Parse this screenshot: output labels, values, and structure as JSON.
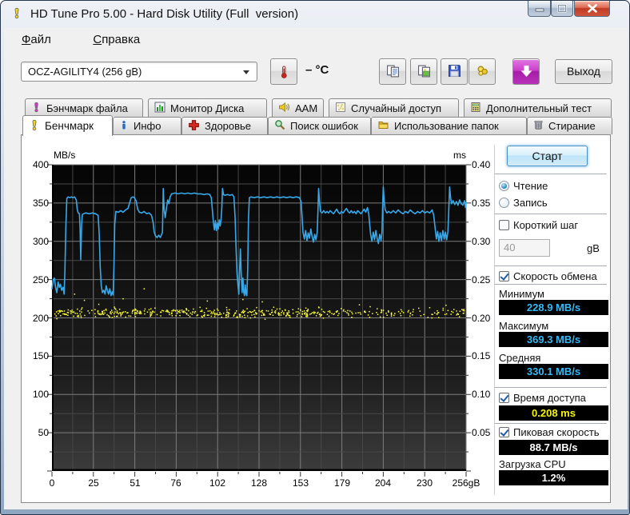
{
  "window": {
    "title": "HD Tune Pro 5.00 - Hard Disk Utility (Full  version)",
    "app_icon": "gauge-yellow-icon",
    "buttons": {
      "minimize": "minimize",
      "maximize": "maximize",
      "close": "close"
    }
  },
  "menu": {
    "items": [
      {
        "label": "Файл"
      },
      {
        "label": "Справка"
      }
    ]
  },
  "toolbar": {
    "drive_select": "OCZ-AGILITY4 (256 gB)",
    "temperature": "– °C",
    "buttons": [
      {
        "name": "copy",
        "icon": "copy-icon"
      },
      {
        "name": "copy-image",
        "icon": "copy-image-icon"
      },
      {
        "name": "save",
        "icon": "save-icon"
      },
      {
        "name": "options",
        "icon": "options-icon"
      },
      {
        "name": "screenshot",
        "icon": "screenshot-icon"
      }
    ],
    "exit_label": "Выход"
  },
  "tabs": {
    "row1": [
      {
        "label": "Бэнчмарк файла",
        "icon": "gauge-magenta-icon"
      },
      {
        "label": "Монитор Диска",
        "icon": "bar-chart-icon"
      },
      {
        "label": "AAM",
        "icon": "speaker-icon"
      },
      {
        "label": "Случайный доступ",
        "icon": "random-access-icon"
      },
      {
        "label": "Дополнительный тест",
        "icon": "calculator-icon"
      }
    ],
    "row2": [
      {
        "label": "Бенчмарк",
        "icon": "gauge-yellow-icon",
        "active": true
      },
      {
        "label": "Инфо",
        "icon": "info-icon"
      },
      {
        "label": "Здоровье",
        "icon": "health-cross-icon"
      },
      {
        "label": "Поиск ошибок",
        "icon": "magnifier-icon"
      },
      {
        "label": "Использование папок",
        "icon": "folder-icon"
      },
      {
        "label": "Стирание",
        "icon": "trash-icon"
      }
    ]
  },
  "benchmark_panel": {
    "start_button": "Старт",
    "read_radio": "Чтение",
    "write_radio": "Запись",
    "short_stride_checkbox": "Короткий шаг",
    "stride_value": "40",
    "stride_unit": "gB",
    "transfer_checkbox": "Скорость обмена",
    "min_label": "Минимум",
    "min_value": "228.9 MB/s",
    "max_label": "Максимум",
    "max_value": "369.3 MB/s",
    "avg_label": "Средняя",
    "avg_value": "330.1 MB/s",
    "access_checkbox": "Время доступа",
    "access_value": "0.208 ms",
    "burst_checkbox": "Пиковая скорость",
    "burst_value": "88.7 MB/s",
    "cpu_label": "Загрузка CPU",
    "cpu_value": "1.2%"
  },
  "chart_data": {
    "type": "line",
    "title": "",
    "x_axis": {
      "range": [
        0,
        256
      ],
      "ticks": [
        "0",
        "25",
        "51",
        "76",
        "102",
        "128",
        "153",
        "179",
        "204",
        "230",
        "256gB"
      ]
    },
    "y_left": {
      "label": "MB/s",
      "range": [
        0,
        400
      ],
      "ticks": [
        400,
        350,
        300,
        250,
        200,
        150,
        100,
        50
      ]
    },
    "y_right": {
      "label": "ms",
      "range": [
        0,
        0.4
      ],
      "ticks": [
        "0.40",
        "0.35",
        "0.30",
        "0.25",
        "0.20",
        "0.15",
        "0.10",
        "0.05"
      ]
    },
    "grid": {
      "major_color": "#7d7d7d",
      "minor_color": "#484848"
    },
    "series": [
      {
        "name": "transfer-rate",
        "type": "line",
        "color": "#37a8ea",
        "points": [
          [
            0,
            238
          ],
          [
            0.8,
            250
          ],
          [
            1.5,
            252
          ],
          [
            2.2,
            240
          ],
          [
            3,
            233
          ],
          [
            3.8,
            247
          ],
          [
            4.5,
            240
          ],
          [
            5.2,
            244
          ],
          [
            6,
            236
          ],
          [
            6.8,
            240
          ],
          [
            7.5,
            231
          ],
          [
            8,
            262
          ],
          [
            8.6,
            320
          ],
          [
            9.2,
            356
          ],
          [
            10,
            358
          ],
          [
            11,
            357
          ],
          [
            12,
            358
          ],
          [
            13,
            357
          ],
          [
            14,
            358
          ],
          [
            15,
            354
          ],
          [
            15.6,
            342
          ],
          [
            16.2,
            337
          ],
          [
            17,
            336
          ],
          [
            17.4,
            315
          ],
          [
            17.8,
            276
          ],
          [
            18.3,
            320
          ],
          [
            18.8,
            335
          ],
          [
            19.5,
            336
          ],
          [
            21,
            337
          ],
          [
            23,
            336
          ],
          [
            25,
            337
          ],
          [
            27,
            336
          ],
          [
            28.5,
            334
          ],
          [
            29.2,
            310
          ],
          [
            29.8,
            268
          ],
          [
            30.5,
            242
          ],
          [
            31.2,
            233
          ],
          [
            32,
            236
          ],
          [
            32.8,
            231
          ],
          [
            33.5,
            242
          ],
          [
            34.2,
            236
          ],
          [
            35,
            231
          ],
          [
            35.8,
            238
          ],
          [
            36.5,
            229
          ],
          [
            37.2,
            234
          ],
          [
            37.8,
            230
          ],
          [
            38.3,
            266
          ],
          [
            38.8,
            322
          ],
          [
            39.5,
            339
          ],
          [
            41,
            338
          ],
          [
            42.5,
            340
          ],
          [
            44,
            338
          ],
          [
            45.5,
            341
          ],
          [
            47,
            343
          ],
          [
            48,
            350
          ],
          [
            49,
            357
          ],
          [
            50,
            358
          ],
          [
            51,
            357
          ],
          [
            52,
            353
          ],
          [
            53,
            342
          ],
          [
            54,
            338
          ],
          [
            55.5,
            337
          ],
          [
            57,
            339
          ],
          [
            58.5,
            336
          ],
          [
            60,
            337
          ],
          [
            61.5,
            334
          ],
          [
            62.5,
            325
          ],
          [
            63.2,
            312
          ],
          [
            64,
            307
          ],
          [
            65,
            305
          ],
          [
            66,
            308
          ],
          [
            67,
            305
          ],
          [
            67.8,
            309
          ],
          [
            68.3,
            312
          ],
          [
            68.8,
            369
          ],
          [
            69.4,
            341
          ],
          [
            70,
            331
          ],
          [
            70.8,
            344
          ],
          [
            71.5,
            354
          ],
          [
            72.3,
            349
          ],
          [
            73,
            358
          ],
          [
            74,
            362
          ],
          [
            76,
            363
          ],
          [
            78,
            362
          ],
          [
            80,
            363
          ],
          [
            82,
            362
          ],
          [
            84,
            363
          ],
          [
            86,
            362
          ],
          [
            88,
            363
          ],
          [
            90,
            362
          ],
          [
            92,
            362
          ],
          [
            94,
            361
          ],
          [
            96,
            362
          ],
          [
            97.5,
            361
          ],
          [
            98.5,
            357
          ],
          [
            99.2,
            340
          ],
          [
            99.8,
            325
          ],
          [
            100.4,
            315
          ],
          [
            101,
            327
          ],
          [
            101.6,
            314
          ],
          [
            102.2,
            324
          ],
          [
            102.8,
            316
          ],
          [
            103.4,
            328
          ],
          [
            104,
            320
          ],
          [
            104.6,
            331
          ],
          [
            105,
            345
          ],
          [
            105.4,
            369
          ],
          [
            106,
            361
          ],
          [
            107,
            360
          ],
          [
            108.5,
            361
          ],
          [
            110,
            360
          ],
          [
            111.5,
            361
          ],
          [
            112.5,
            358
          ],
          [
            113.2,
            330
          ],
          [
            113.8,
            290
          ],
          [
            114.4,
            258
          ],
          [
            115,
            242
          ],
          [
            115.5,
            231
          ],
          [
            116,
            262
          ],
          [
            116.5,
            290
          ],
          [
            117,
            258
          ],
          [
            117.5,
            233
          ],
          [
            118,
            252
          ],
          [
            118.5,
            234
          ],
          [
            119,
            229
          ],
          [
            119.5,
            243
          ],
          [
            120,
            231
          ],
          [
            120.5,
            229
          ],
          [
            121,
            262
          ],
          [
            121.5,
            330
          ],
          [
            122,
            357
          ],
          [
            123,
            358
          ],
          [
            125,
            357
          ],
          [
            127,
            358
          ],
          [
            129,
            357
          ],
          [
            131,
            358
          ],
          [
            133,
            357
          ],
          [
            135,
            358
          ],
          [
            137,
            357
          ],
          [
            139,
            358
          ],
          [
            141,
            357
          ],
          [
            143,
            358
          ],
          [
            145,
            357
          ],
          [
            147,
            358
          ],
          [
            149,
            357
          ],
          [
            151,
            358
          ],
          [
            153,
            357
          ],
          [
            154,
            352
          ],
          [
            154.6,
            333
          ],
          [
            155.2,
            312
          ],
          [
            156,
            303
          ],
          [
            156.8,
            314
          ],
          [
            157.6,
            301
          ],
          [
            158.4,
            311
          ],
          [
            159.2,
            304
          ],
          [
            160,
            316
          ],
          [
            160.8,
            306
          ],
          [
            161.6,
            299
          ],
          [
            162.4,
            309
          ],
          [
            163.2,
            302
          ],
          [
            164,
            312
          ],
          [
            164.4,
            340
          ],
          [
            164.8,
            369
          ],
          [
            165.4,
            351
          ],
          [
            166,
            339
          ],
          [
            167,
            337
          ],
          [
            168,
            340
          ],
          [
            169,
            337
          ],
          [
            170,
            339
          ],
          [
            171,
            337
          ],
          [
            172,
            340
          ],
          [
            173,
            338
          ],
          [
            174,
            336
          ],
          [
            175,
            339
          ],
          [
            176,
            342
          ],
          [
            177,
            338
          ],
          [
            178,
            336
          ],
          [
            179,
            339
          ],
          [
            180,
            337
          ],
          [
            181,
            340
          ],
          [
            182,
            343
          ],
          [
            183,
            339
          ],
          [
            184,
            337
          ],
          [
            185,
            340
          ],
          [
            186,
            337
          ],
          [
            187,
            339
          ],
          [
            188,
            336
          ],
          [
            189,
            340
          ],
          [
            190,
            338
          ],
          [
            191,
            336
          ],
          [
            192,
            339
          ],
          [
            193,
            342
          ],
          [
            194,
            338
          ],
          [
            195,
            344
          ],
          [
            195.8,
            336
          ],
          [
            196.4,
            322
          ],
          [
            197,
            309
          ],
          [
            197.8,
            300
          ],
          [
            198.6,
            312
          ],
          [
            199.4,
            302
          ],
          [
            200.2,
            314
          ],
          [
            201,
            304
          ],
          [
            201.8,
            297
          ],
          [
            202.6,
            309
          ],
          [
            203.4,
            301
          ],
          [
            204,
            312
          ],
          [
            204.4,
            345
          ],
          [
            204.8,
            371
          ],
          [
            205.4,
            352
          ],
          [
            206,
            341
          ],
          [
            207,
            337
          ],
          [
            208,
            339
          ],
          [
            209.5,
            337
          ],
          [
            211,
            340
          ],
          [
            212.5,
            337
          ],
          [
            214,
            341
          ],
          [
            215.5,
            338
          ],
          [
            217,
            336
          ],
          [
            218.5,
            339
          ],
          [
            220,
            337
          ],
          [
            221.5,
            341
          ],
          [
            223,
            338
          ],
          [
            224.5,
            336
          ],
          [
            226,
            339
          ],
          [
            227.5,
            337
          ],
          [
            229,
            340
          ],
          [
            230.5,
            337
          ],
          [
            232,
            339
          ],
          [
            233.5,
            337
          ],
          [
            235,
            341
          ],
          [
            236,
            334
          ],
          [
            236.8,
            318
          ],
          [
            237.6,
            303
          ],
          [
            238.4,
            313
          ],
          [
            239.2,
            300
          ],
          [
            240,
            311
          ],
          [
            240.8,
            301
          ],
          [
            241.6,
            314
          ],
          [
            242.4,
            303
          ],
          [
            243.2,
            312
          ],
          [
            244,
            302
          ],
          [
            244.8,
            313
          ],
          [
            245.3,
            340
          ],
          [
            245.8,
            371
          ],
          [
            246.4,
            357
          ],
          [
            247,
            349
          ],
          [
            248,
            353
          ],
          [
            249,
            348
          ],
          [
            250,
            352
          ],
          [
            251,
            347
          ],
          [
            252,
            354
          ],
          [
            253,
            349
          ],
          [
            254,
            347
          ],
          [
            255,
            353
          ],
          [
            255.6,
            344
          ],
          [
            256,
            351
          ]
        ]
      },
      {
        "name": "access-time",
        "type": "scatter",
        "color": "#ffff38",
        "band": {
          "count": 420,
          "left_extra": 80,
          "x_range": [
            1,
            255
          ],
          "y_center": 206.5,
          "y_jitter": 3.5,
          "seed": 987654321
        },
        "outliers": [
          [
            14,
            231
          ],
          [
            57,
            238
          ],
          [
            3,
            199
          ],
          [
            118,
            224
          ],
          [
            130,
            221
          ],
          [
            96,
            222
          ],
          [
            44,
            225
          ],
          [
            20,
            223
          ]
        ]
      }
    ]
  }
}
